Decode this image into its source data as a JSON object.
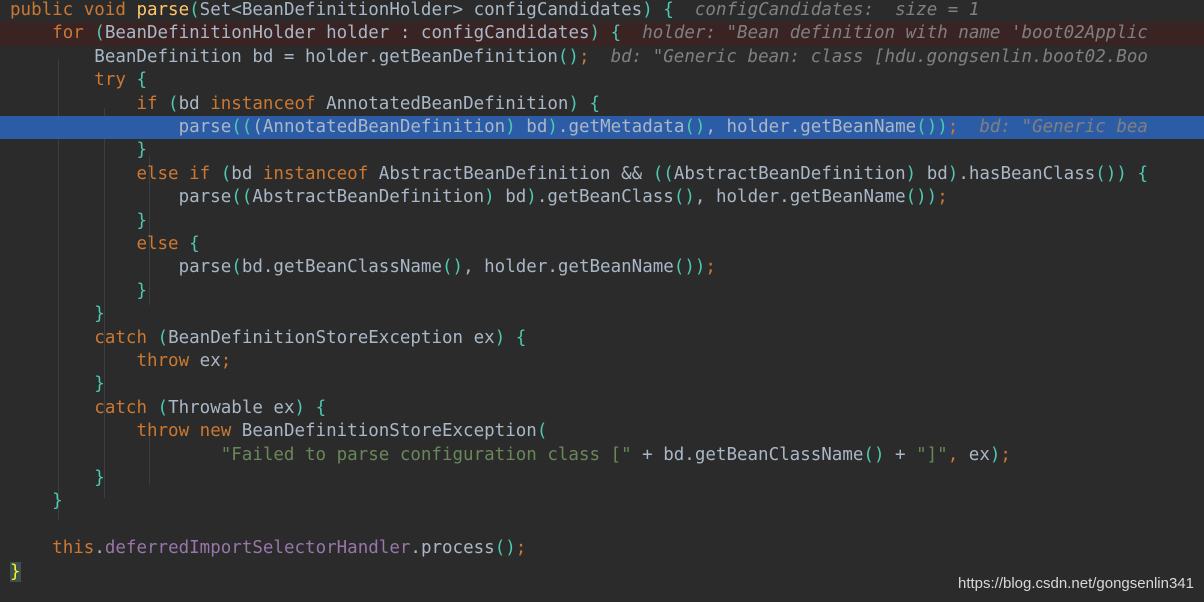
{
  "editor": {
    "watermark": "https://blog.csdn.net/gongsenlin341",
    "colors": {
      "background": "#2b2b2b",
      "keyword": "#cc7832",
      "function": "#ffc66d",
      "identifier": "#a9b7c6",
      "string": "#6a8759",
      "inline_hint": "#808080",
      "bracket": "#4ec9b0",
      "field": "#9876aa",
      "current_line": "#2d5ca6",
      "breakpoint_line": "#3a2323"
    },
    "lines": [
      {
        "hl": "",
        "tokens": [
          {
            "t": "kw",
            "v": "public void "
          },
          {
            "t": "fn",
            "v": "parse"
          },
          {
            "t": "br",
            "v": "("
          },
          {
            "t": "id",
            "v": "Set<BeanDefinitionHolder> configCandidates"
          },
          {
            "t": "br",
            "v": ")"
          },
          {
            "t": "pu",
            "v": " "
          },
          {
            "t": "br",
            "v": "{"
          },
          {
            "t": "co",
            "v": "  configCandidates:  size = 1"
          }
        ]
      },
      {
        "hl": "red",
        "tokens": [
          {
            "t": "id",
            "v": "    "
          },
          {
            "t": "kw",
            "v": "for "
          },
          {
            "t": "br",
            "v": "("
          },
          {
            "t": "id",
            "v": "BeanDefinitionHolder holder : configCandidates"
          },
          {
            "t": "br",
            "v": ")"
          },
          {
            "t": "pu",
            "v": " "
          },
          {
            "t": "br",
            "v": "{"
          },
          {
            "t": "co",
            "v": "  holder: \"Bean definition with name 'boot02Applic"
          }
        ]
      },
      {
        "hl": "",
        "tokens": [
          {
            "t": "id",
            "v": "        BeanDefinition bd = holder.getBeanDefinition"
          },
          {
            "t": "br",
            "v": "()"
          },
          {
            "t": "kw",
            "v": ";"
          },
          {
            "t": "co",
            "v": "  bd: \"Generic bean: class [hdu.gongsenlin.boot02.Boo"
          }
        ]
      },
      {
        "hl": "",
        "tokens": [
          {
            "t": "id",
            "v": "        "
          },
          {
            "t": "kw",
            "v": "try "
          },
          {
            "t": "br",
            "v": "{"
          }
        ]
      },
      {
        "hl": "",
        "tokens": [
          {
            "t": "id",
            "v": "            "
          },
          {
            "t": "kw",
            "v": "if "
          },
          {
            "t": "br",
            "v": "("
          },
          {
            "t": "id",
            "v": "bd "
          },
          {
            "t": "kw",
            "v": "instanceof "
          },
          {
            "t": "id",
            "v": "AnnotatedBeanDefinition"
          },
          {
            "t": "br",
            "v": ")"
          },
          {
            "t": "pu",
            "v": " "
          },
          {
            "t": "br",
            "v": "{"
          }
        ]
      },
      {
        "hl": "blue",
        "tokens": [
          {
            "t": "id",
            "v": "                parse"
          },
          {
            "t": "br",
            "v": "(("
          },
          {
            "t": "id",
            "v": "(AnnotatedBeanDefinition"
          },
          {
            "t": "br",
            "v": ")"
          },
          {
            "t": "id",
            "v": " bd"
          },
          {
            "t": "br",
            "v": ")"
          },
          {
            "t": "id",
            "v": ".getMetadata"
          },
          {
            "t": "br",
            "v": "()"
          },
          {
            "t": "id",
            "v": ", holder.getBeanName"
          },
          {
            "t": "br",
            "v": "())"
          },
          {
            "t": "kw",
            "v": ";"
          },
          {
            "t": "co",
            "v": "  bd: \"Generic bea"
          }
        ]
      },
      {
        "hl": "",
        "tokens": [
          {
            "t": "id",
            "v": "            "
          },
          {
            "t": "br",
            "v": "}"
          }
        ]
      },
      {
        "hl": "",
        "tokens": [
          {
            "t": "id",
            "v": "            "
          },
          {
            "t": "kw",
            "v": "else if "
          },
          {
            "t": "br",
            "v": "("
          },
          {
            "t": "id",
            "v": "bd "
          },
          {
            "t": "kw",
            "v": "instanceof "
          },
          {
            "t": "id",
            "v": "AbstractBeanDefinition && "
          },
          {
            "t": "br",
            "v": "(("
          },
          {
            "t": "id",
            "v": "AbstractBeanDefinition"
          },
          {
            "t": "br",
            "v": ")"
          },
          {
            "t": "id",
            "v": " bd"
          },
          {
            "t": "br",
            "v": ")"
          },
          {
            "t": "id",
            "v": ".hasBeanClass"
          },
          {
            "t": "br",
            "v": "())"
          },
          {
            "t": "pu",
            "v": " "
          },
          {
            "t": "br",
            "v": "{"
          }
        ]
      },
      {
        "hl": "",
        "tokens": [
          {
            "t": "id",
            "v": "                parse"
          },
          {
            "t": "br",
            "v": "(("
          },
          {
            "t": "id",
            "v": "AbstractBeanDefinition"
          },
          {
            "t": "br",
            "v": ")"
          },
          {
            "t": "id",
            "v": " bd"
          },
          {
            "t": "br",
            "v": ")"
          },
          {
            "t": "id",
            "v": ".getBeanClass"
          },
          {
            "t": "br",
            "v": "()"
          },
          {
            "t": "id",
            "v": ", holder.getBeanName"
          },
          {
            "t": "br",
            "v": "())"
          },
          {
            "t": "kw",
            "v": ";"
          }
        ]
      },
      {
        "hl": "",
        "tokens": [
          {
            "t": "id",
            "v": "            "
          },
          {
            "t": "br",
            "v": "}"
          }
        ]
      },
      {
        "hl": "",
        "tokens": [
          {
            "t": "id",
            "v": "            "
          },
          {
            "t": "kw",
            "v": "else "
          },
          {
            "t": "br",
            "v": "{"
          }
        ]
      },
      {
        "hl": "",
        "tokens": [
          {
            "t": "id",
            "v": "                parse"
          },
          {
            "t": "br",
            "v": "("
          },
          {
            "t": "id",
            "v": "bd.getBeanClassName"
          },
          {
            "t": "br",
            "v": "()"
          },
          {
            "t": "id",
            "v": ", holder.getBeanName"
          },
          {
            "t": "br",
            "v": "())"
          },
          {
            "t": "kw",
            "v": ";"
          }
        ]
      },
      {
        "hl": "",
        "tokens": [
          {
            "t": "id",
            "v": "            "
          },
          {
            "t": "br",
            "v": "}"
          }
        ]
      },
      {
        "hl": "",
        "tokens": [
          {
            "t": "id",
            "v": "        "
          },
          {
            "t": "br",
            "v": "}"
          }
        ]
      },
      {
        "hl": "",
        "tokens": [
          {
            "t": "id",
            "v": "        "
          },
          {
            "t": "kw",
            "v": "catch "
          },
          {
            "t": "br",
            "v": "("
          },
          {
            "t": "id",
            "v": "BeanDefinitionStoreException ex"
          },
          {
            "t": "br",
            "v": ")"
          },
          {
            "t": "pu",
            "v": " "
          },
          {
            "t": "br",
            "v": "{"
          }
        ]
      },
      {
        "hl": "",
        "tokens": [
          {
            "t": "id",
            "v": "            "
          },
          {
            "t": "kw",
            "v": "throw "
          },
          {
            "t": "id",
            "v": "ex"
          },
          {
            "t": "kw",
            "v": ";"
          }
        ]
      },
      {
        "hl": "",
        "tokens": [
          {
            "t": "id",
            "v": "        "
          },
          {
            "t": "br",
            "v": "}"
          }
        ]
      },
      {
        "hl": "",
        "tokens": [
          {
            "t": "id",
            "v": "        "
          },
          {
            "t": "kw",
            "v": "catch "
          },
          {
            "t": "br",
            "v": "("
          },
          {
            "t": "id",
            "v": "Throwable ex"
          },
          {
            "t": "br",
            "v": ")"
          },
          {
            "t": "pu",
            "v": " "
          },
          {
            "t": "br",
            "v": "{"
          }
        ]
      },
      {
        "hl": "",
        "tokens": [
          {
            "t": "id",
            "v": "            "
          },
          {
            "t": "kw",
            "v": "throw new "
          },
          {
            "t": "id",
            "v": "BeanDefinitionStoreException"
          },
          {
            "t": "br",
            "v": "("
          }
        ]
      },
      {
        "hl": "",
        "tokens": [
          {
            "t": "id",
            "v": "                    "
          },
          {
            "t": "st",
            "v": "\"Failed to parse configuration class [\""
          },
          {
            "t": "id",
            "v": " + bd.getBeanClassName"
          },
          {
            "t": "br",
            "v": "()"
          },
          {
            "t": "id",
            "v": " + "
          },
          {
            "t": "st",
            "v": "\"]\""
          },
          {
            "t": "kw",
            "v": ", "
          },
          {
            "t": "id",
            "v": "ex"
          },
          {
            "t": "br",
            "v": ")"
          },
          {
            "t": "kw",
            "v": ";"
          }
        ]
      },
      {
        "hl": "",
        "tokens": [
          {
            "t": "id",
            "v": "        "
          },
          {
            "t": "br",
            "v": "}"
          }
        ]
      },
      {
        "hl": "",
        "tokens": [
          {
            "t": "id",
            "v": "    "
          },
          {
            "t": "br",
            "v": "}"
          }
        ]
      },
      {
        "hl": "",
        "tokens": [
          {
            "t": "id",
            "v": ""
          }
        ]
      },
      {
        "hl": "",
        "tokens": [
          {
            "t": "id",
            "v": "    "
          },
          {
            "t": "kw",
            "v": "this"
          },
          {
            "t": "id",
            "v": "."
          },
          {
            "t": "fd",
            "v": "deferredImportSelectorHandler"
          },
          {
            "t": "id",
            "v": ".process"
          },
          {
            "t": "br",
            "v": "()"
          },
          {
            "t": "kw",
            "v": ";"
          }
        ]
      },
      {
        "hl": "",
        "tokens": [
          {
            "t": "hlbrace",
            "v": "}"
          }
        ]
      }
    ]
  }
}
